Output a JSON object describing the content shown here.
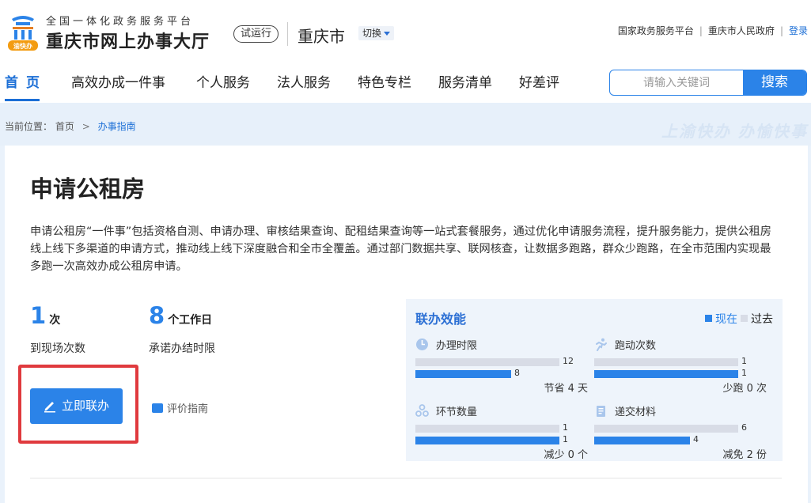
{
  "header": {
    "platform_subtitle": "全国一体化政务服务平台",
    "site_title": "重庆市网上办事大厅",
    "logo_caption": "渝快办",
    "trial_badge": "试运行",
    "city": "重庆市",
    "switch_label": "切换",
    "links": [
      "国家政务服务平台",
      "重庆市人民政府",
      "登录"
    ],
    "separator": "|"
  },
  "nav": {
    "items": [
      "首页",
      "高效办成一件事",
      "个人服务",
      "法人服务",
      "特色专栏",
      "服务清单",
      "好差评"
    ],
    "active_index": 0
  },
  "search": {
    "placeholder": "请输入关键词",
    "button_label": "搜索"
  },
  "breadcrumb": {
    "prefix": "当前位置：",
    "home": "首页",
    "separator": ">",
    "current": "办事指南",
    "slogan": "上渝快办 办愉快事"
  },
  "main": {
    "title": "申请公租房",
    "description": "申请公租房“一件事”包括资格自测、申请办理、审核结果查询、配租结果查询等一站式套餐服务，通过优化申请服务流程，提升服务能力，提供公租房线上线下多渠道的申请方式，推动线上线下深度融合和全市全覆盖。通过部门数据共享、联网核查，让数据多跑路，群众少跑路，在全市范围内实现最多跑一次高效办成公租房申请。",
    "stats": [
      {
        "value": "1",
        "unit": "次",
        "label": "到现场次数"
      },
      {
        "value": "8",
        "unit": "个工作日",
        "label": "承诺办结时限"
      }
    ],
    "apply_button": "立即联办",
    "eval_link": "评价指南"
  },
  "efficiency": {
    "title": "联办效能",
    "legend_now": "现在",
    "legend_past": "过去",
    "colors": {
      "now": "#2b83e8",
      "past": "#d8dce6"
    },
    "metrics": [
      {
        "icon": "clock-icon",
        "label": "办理时限",
        "past": 12,
        "now": 8,
        "summary": "节省 4 天"
      },
      {
        "icon": "running-icon",
        "label": "跑动次数",
        "past": 1,
        "now": 1,
        "summary": "少跑 0 次"
      },
      {
        "icon": "link-icon",
        "label": "环节数量",
        "past": 1,
        "now": 1,
        "summary": "减少 0 个"
      },
      {
        "icon": "document-icon",
        "label": "递交材料",
        "past": 6,
        "now": 4,
        "summary": "减免 2 份"
      }
    ]
  }
}
